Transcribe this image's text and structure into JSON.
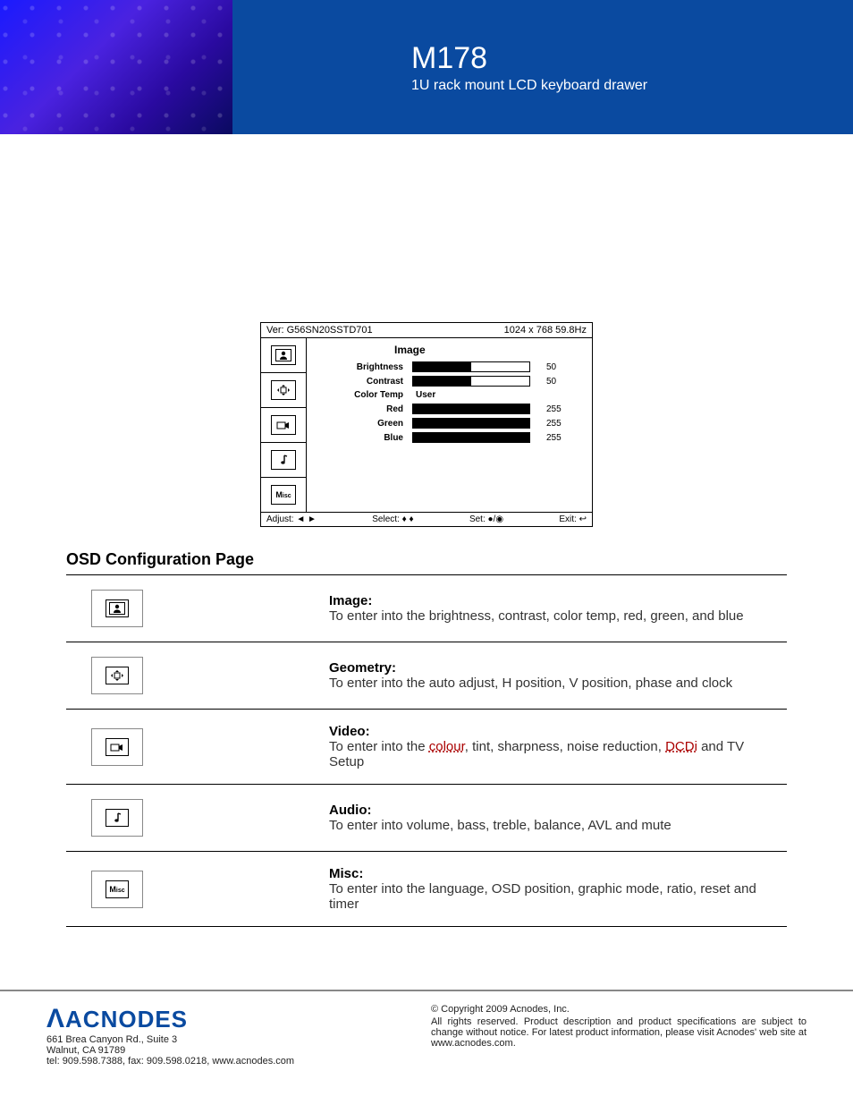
{
  "header": {
    "model": "M178",
    "subtitle": "1U rack mount LCD keyboard drawer"
  },
  "osd": {
    "version_label": "Ver: G56SN20SSTD701",
    "resolution": "1024 x 768  59.8Hz",
    "title": "Image",
    "rows": [
      {
        "label": "Brightness",
        "type": "bar",
        "pct": 50,
        "value": "50"
      },
      {
        "label": "Contrast",
        "type": "bar",
        "pct": 50,
        "value": "50"
      },
      {
        "label": "Color Temp",
        "type": "text",
        "value": "User"
      },
      {
        "label": "Red",
        "type": "bar",
        "pct": 100,
        "value": "255"
      },
      {
        "label": "Green",
        "type": "bar",
        "pct": 100,
        "value": "255"
      },
      {
        "label": "Blue",
        "type": "bar",
        "pct": 100,
        "value": "255"
      }
    ],
    "footer": {
      "adjust": "Adjust: ◄ ►",
      "select": "Select: ♦ ♦",
      "set": "Set: ●/◉",
      "exit": "Exit: ↩"
    },
    "tabs": [
      "image",
      "geometry",
      "video",
      "audio",
      "misc"
    ]
  },
  "config": {
    "heading": "OSD Configuration Page",
    "rows": [
      {
        "icon": "image",
        "title": "Image:",
        "desc": "To enter into the brightness, contrast, color temp, red, green, and blue"
      },
      {
        "icon": "geometry",
        "title": "Geometry:",
        "desc": "To enter into the auto adjust, H position, V position, phase and clock"
      },
      {
        "icon": "video",
        "title": "Video:",
        "desc": "To enter into the <span class='sp'>colour</span>, tint, sharpness, noise reduction, <span class='sp'>DCDi</span> and TV Setup"
      },
      {
        "icon": "audio",
        "title": "Audio:",
        "desc": "To enter into volume, bass, treble, balance, AVL and mute"
      },
      {
        "icon": "misc",
        "title": "Misc:",
        "desc": "To enter into the language, OSD position, graphic mode, ratio, reset and timer"
      }
    ]
  },
  "footer": {
    "brand": "ACNODES",
    "addr1": "661 Brea Canyon Rd., Suite 3",
    "addr2": "Walnut, CA 91789",
    "contact": "tel: 909.598.7388, fax: 909.598.0218, www.acnodes.com",
    "copy": "© Copyright 2009 Acnodes, Inc.",
    "legal": "All rights reserved. Product description and product specifications are subject to change without notice. For latest product information, please visit Acnodes' web site at www.acnodes.com."
  },
  "icons": {
    "image": "person",
    "geometry": "arrows",
    "video": "camera",
    "audio": "note",
    "misc": "misc"
  }
}
